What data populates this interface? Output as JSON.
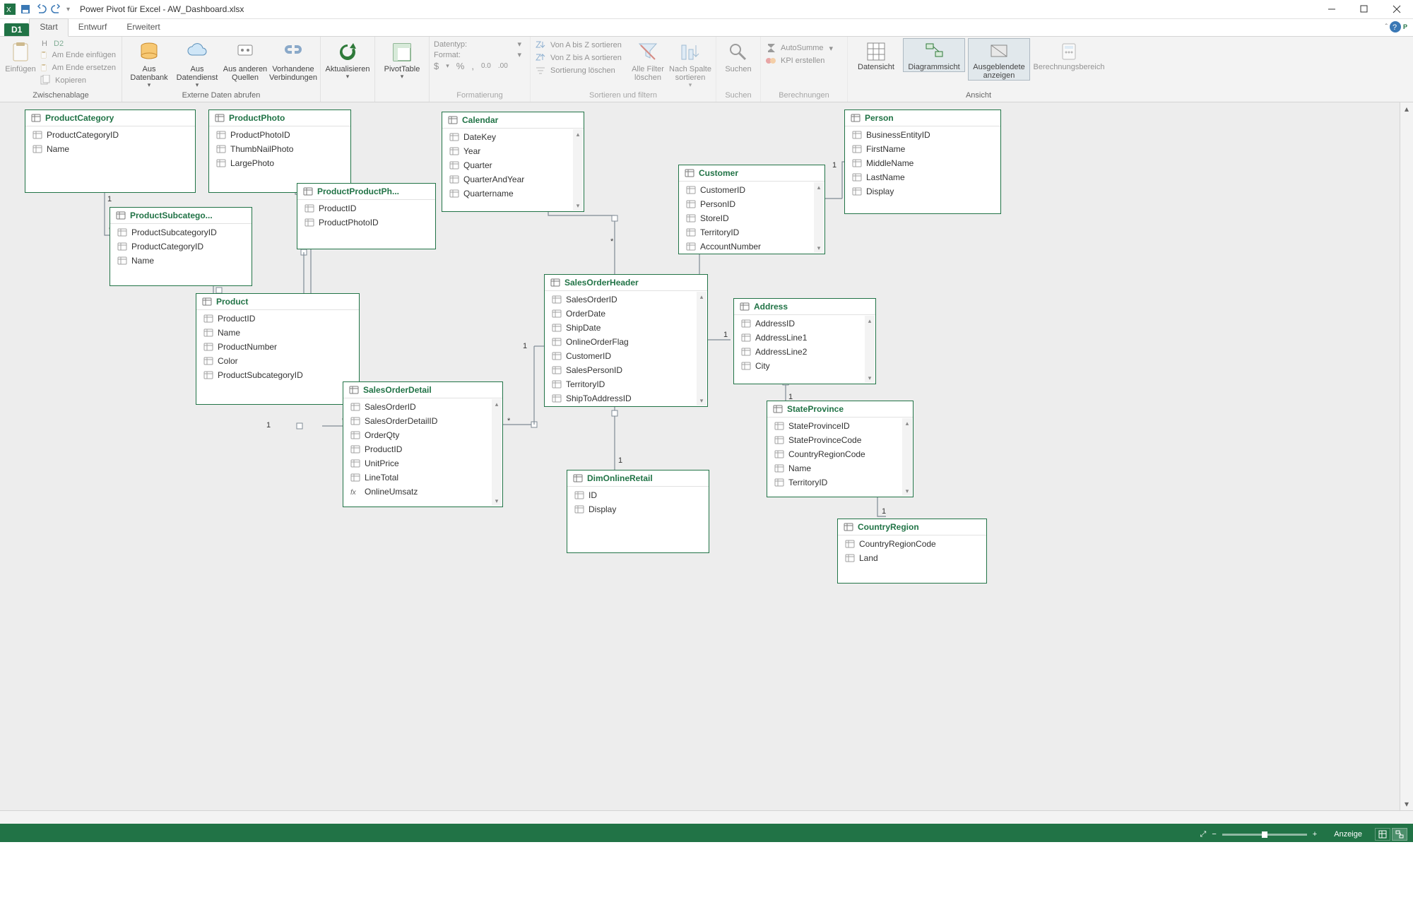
{
  "app": {
    "title": "Power Pivot für Excel - AW_Dashboard.xlsx"
  },
  "workspace": {
    "d1": "D1",
    "d2": "D2"
  },
  "tabs": {
    "start": "Start",
    "entwurf": "Entwurf",
    "erweitert": "Erweitert"
  },
  "ribbon": {
    "zwischenablage": {
      "label": "Zwischenablage",
      "einfuegen": "Einfügen",
      "h": "H",
      "amEndeEinfuegen": "Am Ende einfügen",
      "amEndeErsetzen": "Am Ende ersetzen",
      "kopieren": "Kopieren"
    },
    "externeDaten": {
      "label": "Externe Daten abrufen",
      "ausDatenbank": "Aus Datenbank",
      "ausDatendienst": "Aus Datendienst",
      "ausAnderenQuellen": "Aus anderen Quellen",
      "vorhandeneVerbindungen": "Vorhandene Verbindungen"
    },
    "aktualisieren": "Aktualisieren",
    "pivottable": "PivotTable",
    "formatierung": {
      "label": "Formatierung",
      "datentyp": "Datentyp:",
      "format": "Format:",
      "symbols": "$  ▾   %   ,   ⁰·⁰   ·⁰⁰"
    },
    "sortFilter": {
      "label": "Sortieren und filtern",
      "aToZ": "Von A bis Z sortieren",
      "zToA": "Von Z bis A sortieren",
      "clear": "Sortierung löschen",
      "alleFilterLoeschen": "Alle Filter löschen",
      "nachSpalteSortieren": "Nach Spalte sortieren"
    },
    "suchen": {
      "label": "Suchen",
      "btn": "Suchen"
    },
    "berechnungen": {
      "label": "Berechnungen",
      "autosumme": "AutoSumme",
      "kpi": "KPI erstellen"
    },
    "ansicht": {
      "label": "Ansicht",
      "datensicht": "Datensicht",
      "diagrammsicht": "Diagrammsicht",
      "ausgeblendete": "Ausgeblendete anzeigen",
      "berechnungsbereich": "Berechnungsbereich"
    }
  },
  "tables": {
    "ProductCategory": {
      "title": "ProductCategory",
      "fields": [
        "ProductCategoryID",
        "Name"
      ]
    },
    "ProductPhoto": {
      "title": "ProductPhoto",
      "fields": [
        "ProductPhotoID",
        "ThumbNailPhoto",
        "LargePhoto"
      ]
    },
    "ProductSubcategory": {
      "title": "ProductSubcatego...",
      "fields": [
        "ProductSubcategoryID",
        "ProductCategoryID",
        "Name"
      ]
    },
    "ProductProductPhoto": {
      "title": "ProductProductPh...",
      "fields": [
        "ProductID",
        "ProductPhotoID"
      ]
    },
    "Product": {
      "title": "Product",
      "fields": [
        "ProductID",
        "Name",
        "ProductNumber",
        "Color",
        "ProductSubcategoryID"
      ]
    },
    "SalesOrderDetail": {
      "title": "SalesOrderDetail",
      "fields": [
        "SalesOrderID",
        "SalesOrderDetailID",
        "OrderQty",
        "ProductID",
        "UnitPrice",
        "LineTotal",
        "OnlineUmsatz"
      ]
    },
    "Calendar": {
      "title": "Calendar",
      "fields": [
        "DateKey",
        "Year",
        "Quarter",
        "QuarterAndYear",
        "Quartername"
      ]
    },
    "SalesOrderHeader": {
      "title": "SalesOrderHeader",
      "fields": [
        "SalesOrderID",
        "OrderDate",
        "ShipDate",
        "OnlineOrderFlag",
        "CustomerID",
        "SalesPersonID",
        "TerritoryID",
        "ShipToAddressID"
      ]
    },
    "DimOnlineRetail": {
      "title": "DimOnlineRetail",
      "fields": [
        "ID",
        "Display"
      ]
    },
    "Customer": {
      "title": "Customer",
      "fields": [
        "CustomerID",
        "PersonID",
        "StoreID",
        "TerritoryID",
        "AccountNumber"
      ]
    },
    "Person": {
      "title": "Person",
      "fields": [
        "BusinessEntityID",
        "FirstName",
        "MiddleName",
        "LastName",
        "Display"
      ]
    },
    "Address": {
      "title": "Address",
      "fields": [
        "AddressID",
        "AddressLine1",
        "AddressLine2",
        "City"
      ]
    },
    "StateProvince": {
      "title": "StateProvince",
      "fields": [
        "StateProvinceID",
        "StateProvinceCode",
        "CountryRegionCode",
        "Name",
        "TerritoryID"
      ]
    },
    "CountryRegion": {
      "title": "CountryRegion",
      "fields": [
        "CountryRegionCode",
        "Land"
      ]
    }
  },
  "status": {
    "anzeige": "Anzeige"
  }
}
